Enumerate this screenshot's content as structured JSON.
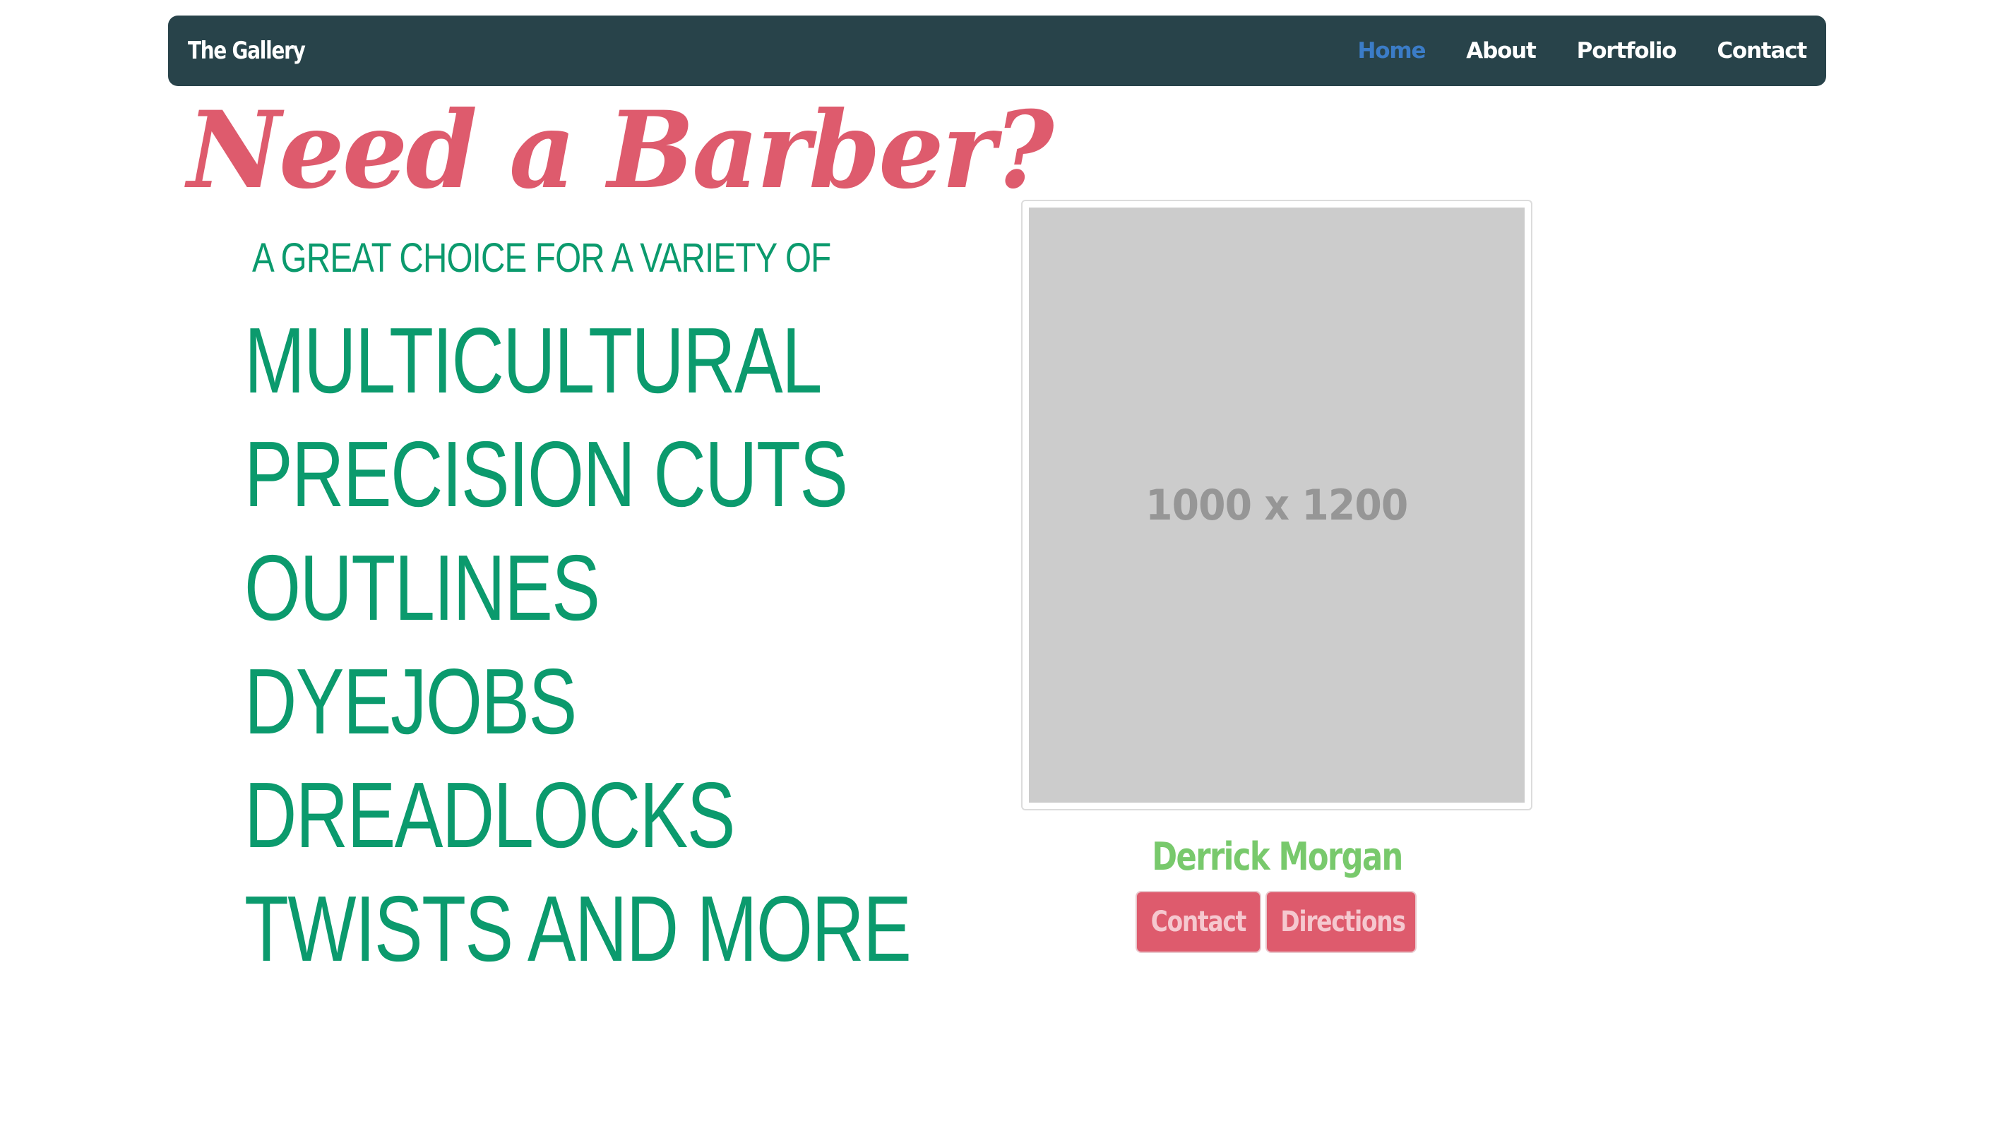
{
  "navbar": {
    "brand": "The Gallery",
    "links": [
      {
        "label": "Home",
        "active": true
      },
      {
        "label": "About",
        "active": false
      },
      {
        "label": "Portfolio",
        "active": false
      },
      {
        "label": "Contact",
        "active": false
      }
    ]
  },
  "hero": {
    "title": "Need a Barber?",
    "tagline": "A GREAT CHOICE FOR A VARIETY OF",
    "services": [
      "MULTICULTURAL",
      "PRECISION CUTS",
      "OUTLINES",
      "DYEJOBS",
      "DREADLOCKS",
      "TWISTS AND MORE"
    ]
  },
  "profile": {
    "image_placeholder": "1000 x 1200",
    "name": "Derrick Morgan",
    "contact_label": "Contact",
    "directions_label": "Directions"
  },
  "colors": {
    "navbar_bg": "#28434a",
    "nav_active": "#3b7cc7",
    "title_pink": "#de5b6d",
    "service_green": "#0b9a6d",
    "name_green": "#78c96c",
    "button_bg": "#de5b6d",
    "placeholder_bg": "#cccccc"
  }
}
